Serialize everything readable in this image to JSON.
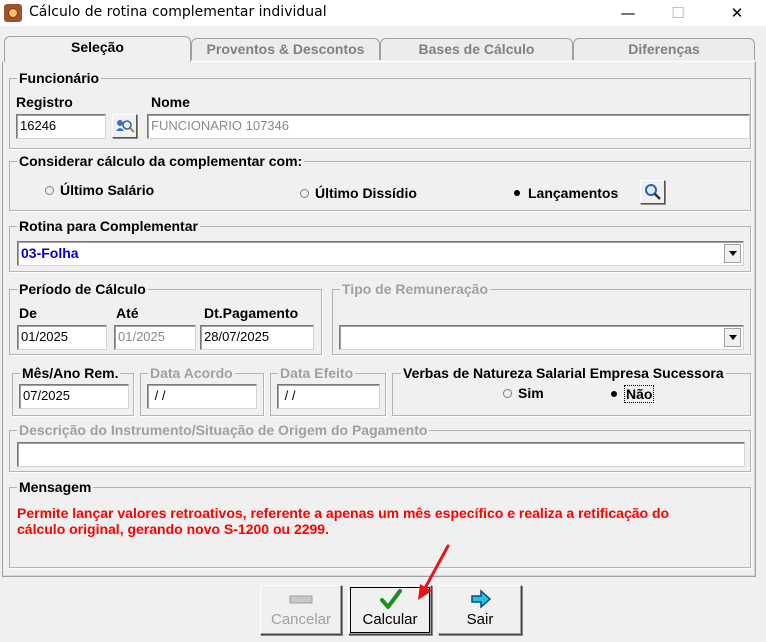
{
  "window": {
    "title": "Cálculo de rotina complementar individual",
    "minimize": "—",
    "maximize": "☐",
    "close": "✕"
  },
  "tabs": [
    {
      "label": "Seleção",
      "active": true
    },
    {
      "label": "Proventos & Descontos"
    },
    {
      "label": "Bases de Cálculo"
    },
    {
      "label": "Diferenças"
    }
  ],
  "funcionario": {
    "title": "Funcionário",
    "registro_label": "Registro",
    "registro_value": "16246",
    "nome_label": "Nome",
    "nome_value": "FUNCIONARIO 107346"
  },
  "considerar": {
    "title": "Considerar cálculo da complementar com:",
    "options": [
      {
        "label": "Último Salário",
        "selected": false
      },
      {
        "label": "Último Dissídio",
        "selected": false
      },
      {
        "label": "Lançamentos",
        "selected": true
      }
    ]
  },
  "rotina": {
    "title": "Rotina para Complementar",
    "value": "03-Folha"
  },
  "periodo": {
    "title": "Período de Cálculo",
    "de_label": "De",
    "de_value": "01/2025",
    "ate_label": "Até",
    "ate_value": "01/2025",
    "pagamento_label": "Dt.Pagamento",
    "pagamento_value": "28/07/2025"
  },
  "tipo_remuneracao": {
    "title": "Tipo de Remuneração",
    "value": ""
  },
  "mes_ano": {
    "title": "Mês/Ano Rem.",
    "value": "07/2025"
  },
  "data_acordo": {
    "title": "Data Acordo",
    "value": " / /"
  },
  "data_efeito": {
    "title": "Data Efeito",
    "value": " / /"
  },
  "verbas": {
    "title": "Verbas de Natureza Salarial Empresa Sucessora",
    "options": [
      {
        "label": "Sim",
        "selected": false
      },
      {
        "label": "Não",
        "selected": true
      }
    ]
  },
  "descricao": {
    "title": "Descrição do Instrumento/Situação de Origem do Pagamento",
    "value": ""
  },
  "mensagem": {
    "title": "Mensagem",
    "line1": "Permite lançar valores retroativos, referente a apenas um mês específico e realiza a retificação do",
    "line2": "cálculo original, gerando novo S-1200 ou 2299."
  },
  "buttons": {
    "cancelar": "Cancelar",
    "calcular": "Calcular",
    "sair": "Sair"
  },
  "colors": {
    "message": "#ff0000",
    "rotina_text": "#0000cc",
    "annotation_arrow": "#e8141b"
  }
}
